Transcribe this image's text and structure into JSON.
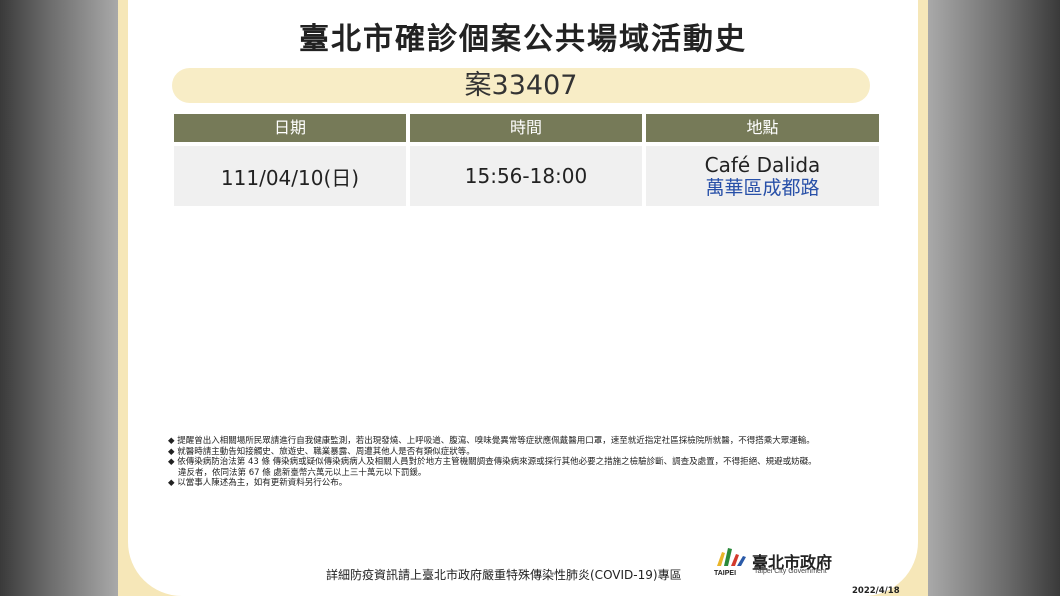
{
  "title": "臺北市確診個案公共場域活動史",
  "case_id": "案33407",
  "table": {
    "headers": [
      "日期",
      "時間",
      "地點"
    ],
    "row": {
      "date": "111/04/10(日)",
      "time": "15:56-18:00",
      "place_name": "Café Dalida",
      "place_area": "萬華區成都路"
    }
  },
  "notes": [
    {
      "text": "◆ 提醒曾出入相關場所民眾請進行自我健康監測，若出現發燒、上呼吸道、腹瀉、嗅味覺異常等症狀應佩戴醫用口罩，速至就近指定社區採檢院所就醫，不得搭乘大眾運輸。"
    },
    {
      "text": "◆ 就醫時請主動告知接觸史、旅遊史、職業暴露、周遭其他人是否有類似症狀等。"
    },
    {
      "text": "◆ 依傳染病防治法第 43 條 傳染病或疑似傳染病病人及相關人員對於地方主管機關調查傳染病來源或採行其他必要之措施之檢驗診斷、調查及處置，不得拒絕、規避或妨礙。",
      "extra": "違反者，依同法第 67 條 處新臺幣六萬元以上三十萬元以下罰鍰。"
    },
    {
      "text": "◆ 以當事人陳述為主，如有更新資料另行公布。"
    }
  ],
  "footer_text": "詳細防疫資訊請上臺北市政府嚴重特殊傳染性肺炎(COVID-19)專區",
  "logo": {
    "en": "TAIPEI",
    "zh": "臺北市政府",
    "sub": "Taipei City Government"
  },
  "date_stamp": "2022/4/18",
  "colors": {
    "frame": "#f6e7b8",
    "header_bg": "#767a58",
    "area_text": "#2850a8"
  }
}
